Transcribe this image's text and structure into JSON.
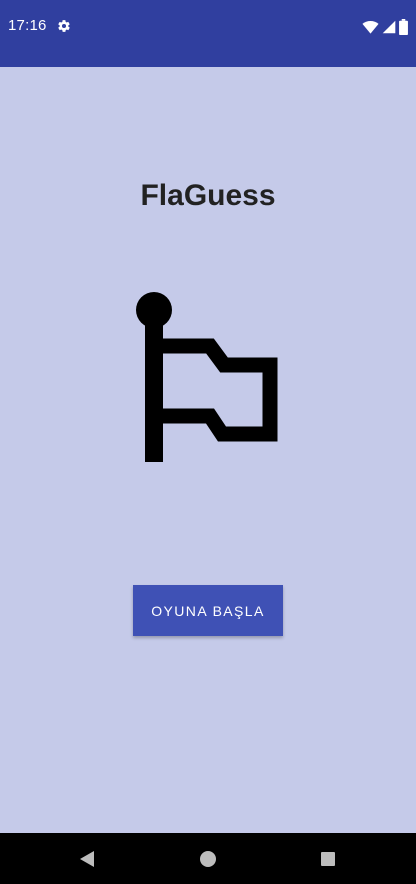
{
  "status_bar": {
    "time": "17:16",
    "icons": [
      "settings-gear-icon",
      "wifi-icon",
      "cell-signal-icon",
      "battery-icon"
    ],
    "background_color": "#303f9f"
  },
  "main": {
    "title": "FlaGuess",
    "image_icon": "flag-icon",
    "start_button_label": "OYUNA BAŞLA",
    "background_color": "#c5cae9",
    "button_color": "#3f51b5"
  },
  "nav_bar": {
    "icons": [
      "back-icon",
      "home-icon",
      "recents-icon"
    ]
  }
}
